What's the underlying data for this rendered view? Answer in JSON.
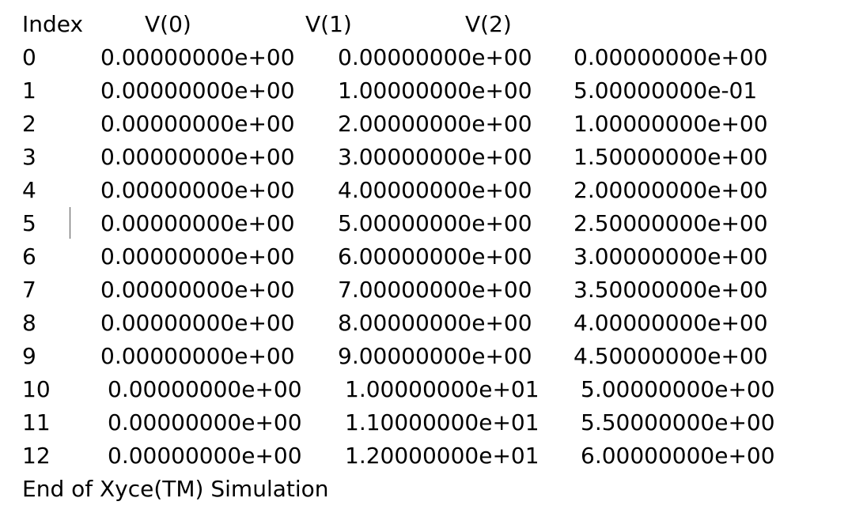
{
  "header": {
    "index": "Index",
    "v0": "V(0)",
    "v1": "V(1)",
    "v2": "V(2)"
  },
  "rows": [
    {
      "index": "0",
      "v0": "0.00000000e+00",
      "v1": "0.00000000e+00",
      "v2": "0.00000000e+00"
    },
    {
      "index": "1",
      "v0": "0.00000000e+00",
      "v1": "1.00000000e+00",
      "v2": "5.00000000e-01"
    },
    {
      "index": "2",
      "v0": "0.00000000e+00",
      "v1": "2.00000000e+00",
      "v2": "1.00000000e+00"
    },
    {
      "index": "3",
      "v0": "0.00000000e+00",
      "v1": "3.00000000e+00",
      "v2": "1.50000000e+00"
    },
    {
      "index": "4",
      "v0": "0.00000000e+00",
      "v1": "4.00000000e+00",
      "v2": "2.00000000e+00"
    },
    {
      "index": "5",
      "v0": "0.00000000e+00",
      "v1": "5.00000000e+00",
      "v2": "2.50000000e+00"
    },
    {
      "index": "6",
      "v0": "0.00000000e+00",
      "v1": "6.00000000e+00",
      "v2": "3.00000000e+00"
    },
    {
      "index": "7",
      "v0": "0.00000000e+00",
      "v1": "7.00000000e+00",
      "v2": "3.50000000e+00"
    },
    {
      "index": "8",
      "v0": "0.00000000e+00",
      "v1": "8.00000000e+00",
      "v2": "4.00000000e+00"
    },
    {
      "index": "9",
      "v0": "0.00000000e+00",
      "v1": "9.00000000e+00",
      "v2": "4.50000000e+00"
    },
    {
      "index": "10",
      "v0": "0.00000000e+00",
      "v1": "1.00000000e+01",
      "v2": "5.00000000e+00"
    },
    {
      "index": "11",
      "v0": "0.00000000e+00",
      "v1": "1.10000000e+01",
      "v2": "5.50000000e+00"
    },
    {
      "index": "12",
      "v0": "0.00000000e+00",
      "v1": "1.20000000e+01",
      "v2": "6.00000000e+00"
    }
  ],
  "footer": "End of Xyce(TM) Simulation"
}
